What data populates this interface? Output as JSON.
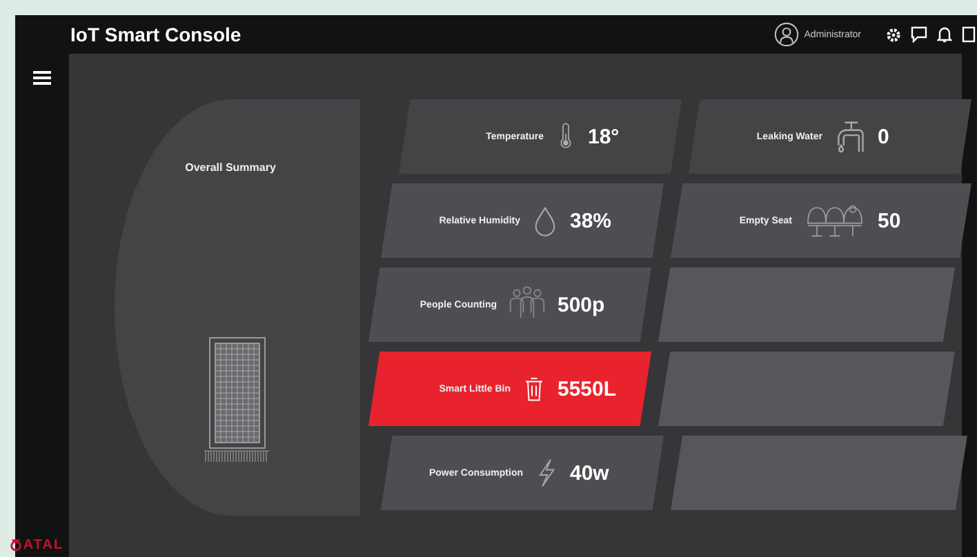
{
  "header": {
    "title": "IoT Smart Console",
    "user": "Administrator"
  },
  "brand": {
    "name": "ATAL"
  },
  "summary": {
    "title": "Overall Summary"
  },
  "rows": [
    {
      "cards": [
        {
          "kind": "temperature",
          "label": "Temperature",
          "value": "18°",
          "alert": false
        },
        {
          "kind": "leak",
          "label": "Leaking Water",
          "value": "0",
          "alert": false
        }
      ]
    },
    {
      "cards": [
        {
          "kind": "humidity",
          "label": "Relative Humidity",
          "value": "38%",
          "alert": false
        },
        {
          "kind": "seat",
          "label": "Empty Seat",
          "value": "50",
          "alert": false
        }
      ]
    },
    {
      "cards": [
        {
          "kind": "people",
          "label": "People Counting",
          "value": "500p",
          "alert": false
        },
        {
          "kind": "blank"
        }
      ]
    },
    {
      "cards": [
        {
          "kind": "bin",
          "label": "Smart Little Bin",
          "value": "5550L",
          "alert": true
        },
        {
          "kind": "blank"
        }
      ]
    },
    {
      "cards": [
        {
          "kind": "power",
          "label": "Power Consumption",
          "value": "40w",
          "alert": false
        },
        {
          "kind": "blank"
        }
      ]
    }
  ]
}
